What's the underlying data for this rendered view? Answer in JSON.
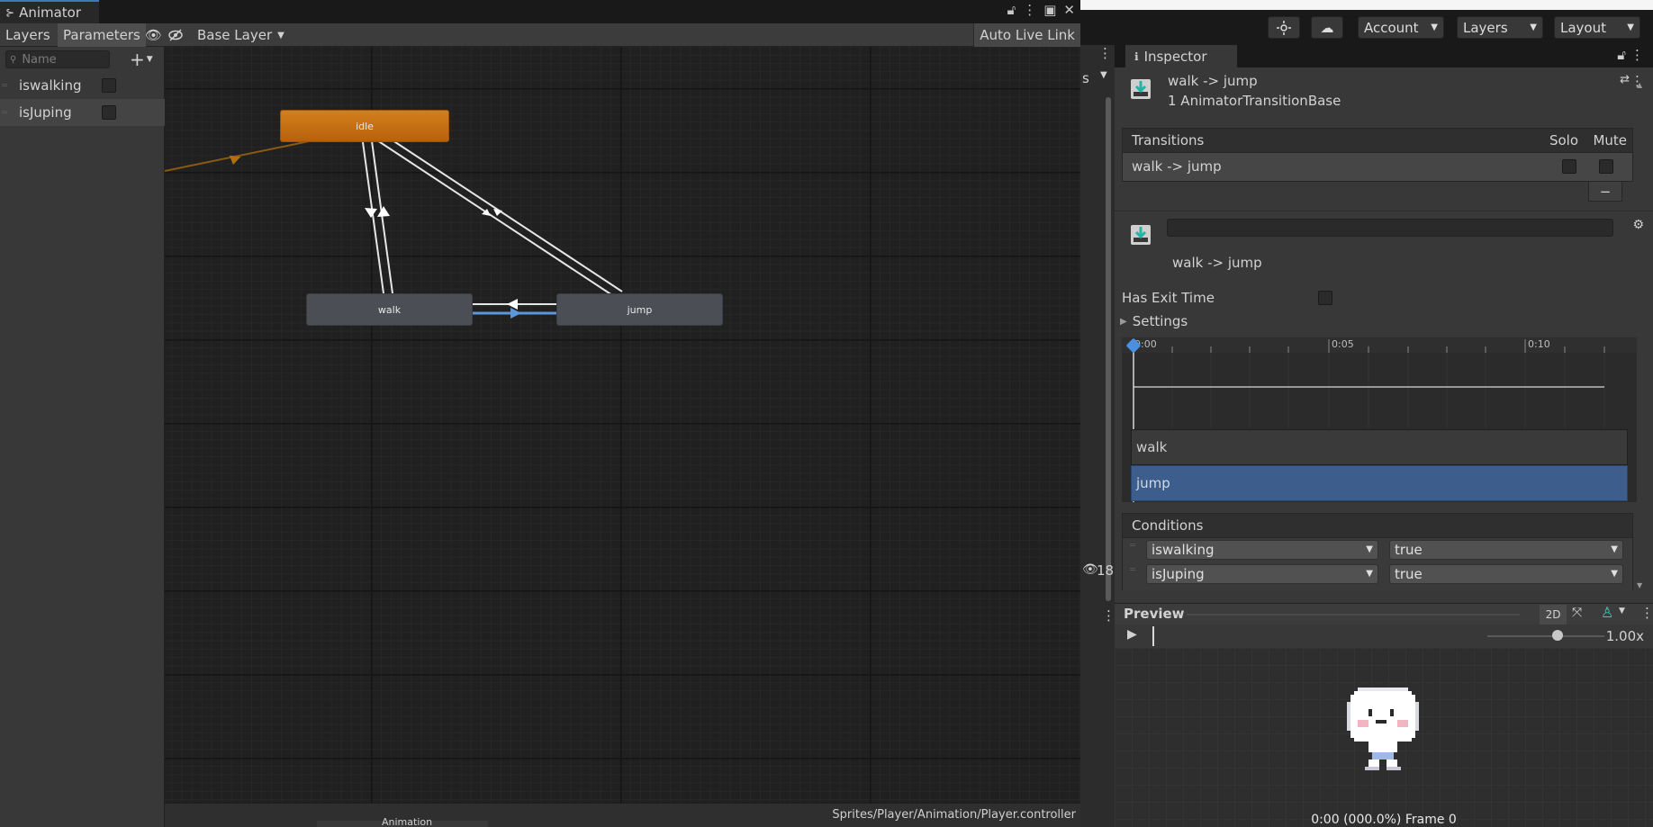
{
  "animator": {
    "tab_label": "Animator",
    "toolbar": {
      "layers_tab": "Layers",
      "parameters_tab": "Parameters",
      "layer_dropdown": "Base Layer",
      "auto_live_link": "Auto Live Link"
    },
    "search_placeholder": "Name",
    "parameters": [
      {
        "name": "iswalking",
        "value": false
      },
      {
        "name": "isJuping",
        "value": false
      }
    ],
    "states": {
      "idle": "idle",
      "walk": "walk",
      "jump": "jump"
    },
    "status_path": "Sprites/Player/Animation/Player.controller",
    "bottom_tab_partial": "Animation"
  },
  "topbar": {
    "account": "Account",
    "layers": "Layers",
    "layout": "Layout"
  },
  "sliver": {
    "letter": "s",
    "count": "18"
  },
  "inspector": {
    "tab_label": "Inspector",
    "title": "walk -> jump",
    "subtitle": "1 AnimatorTransitionBase",
    "transitions_header": "Transitions",
    "solo_label": "Solo",
    "mute_label": "Mute",
    "transition_item": "walk -> jump",
    "minus_label": "−",
    "transition_name_value": "",
    "transition_caption": "walk -> jump",
    "has_exit_time_label": "Has Exit Time",
    "has_exit_time": false,
    "settings_label": "Settings",
    "timeline": {
      "ticks": [
        "0:00",
        "0:05",
        "0:10"
      ],
      "tracks": [
        "walk",
        "jump"
      ]
    },
    "conditions_header": "Conditions",
    "conditions": [
      {
        "param": "iswalking",
        "value": "true"
      },
      {
        "param": "isJuping",
        "value": "true"
      }
    ]
  },
  "preview": {
    "label": "Preview",
    "mode_2d": "2D",
    "speed": "1.00x",
    "speed_level": 0.6,
    "frame_info": "0:00 (000.0%) Frame 0"
  },
  "colors": {
    "idle_state": "#c36e14",
    "accent_blue": "#3a79bb",
    "selected_track": "#3d5e8c",
    "transition_line": "#e6e6e6"
  }
}
